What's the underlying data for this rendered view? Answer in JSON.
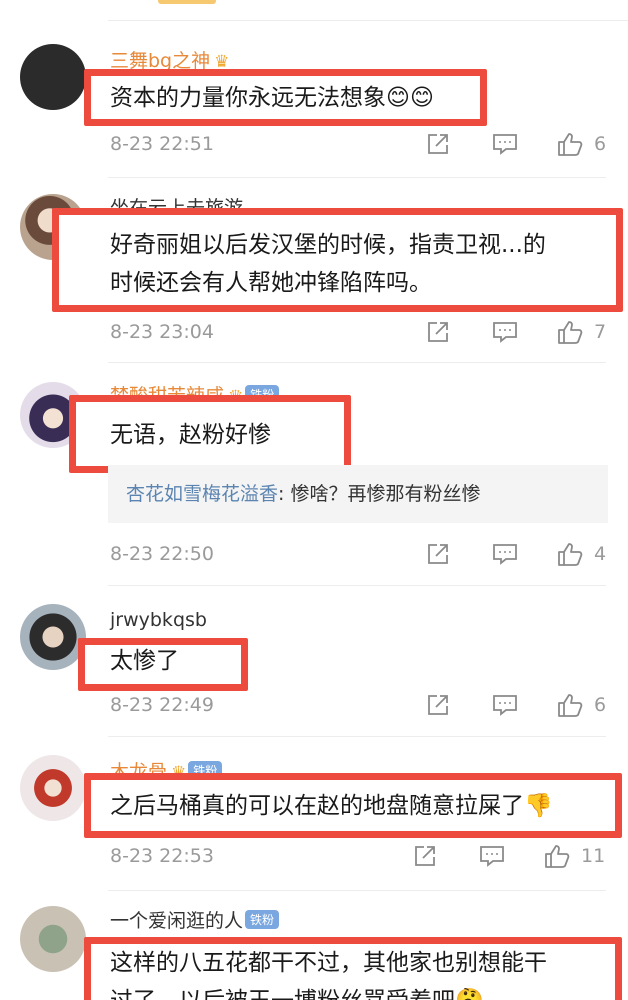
{
  "comments": [
    {
      "username": "三舞bg之神",
      "text": "资本的力量你永远无法想象😊😊",
      "time": "8-23 22:51",
      "likes": "6"
    },
    {
      "username": "坐在云上去旅游",
      "text_line1": "好奇丽姐以后发汉堡的时候，指责卫视...的",
      "text_line2": "时候还会有人帮她冲锋陷阵吗。",
      "time": "8-23 23:04",
      "likes": "7"
    },
    {
      "username": "梦酸甜苦辣咸",
      "fan_badge": "铁粉",
      "text": "无语，赵粉好惨",
      "reply_user": "杏花如雪梅花溢香",
      "reply_text": ": 惨啥？再惨那有粉丝惨",
      "time": "8-23 22:50",
      "likes": "4"
    },
    {
      "username": "jrwybkqsb",
      "text": "太惨了",
      "time": "8-23 22:49",
      "likes": "6"
    },
    {
      "username": "木龙骨",
      "fan_badge": "铁粉",
      "text": "之后马桶真的可以在赵的地盘随意拉屎了👎",
      "time": "8-23 22:53",
      "likes": "11"
    },
    {
      "username": "一个爱闲逛的人",
      "fan_badge": "铁粉",
      "text_line1": "这样的八五花都干不过，其他家也别想能干",
      "text_line2": "过了，以后被王一博粉丝骂受着吧🤔"
    }
  ],
  "colors": {
    "highlight_border": "#ec4b3e",
    "username_orange": "#e8893a",
    "reply_name": "#5b84b1",
    "meta_gray": "#9a9a9a"
  },
  "icons": [
    "share-icon",
    "comment-icon",
    "thumbs-up-icon",
    "crown-icon"
  ]
}
